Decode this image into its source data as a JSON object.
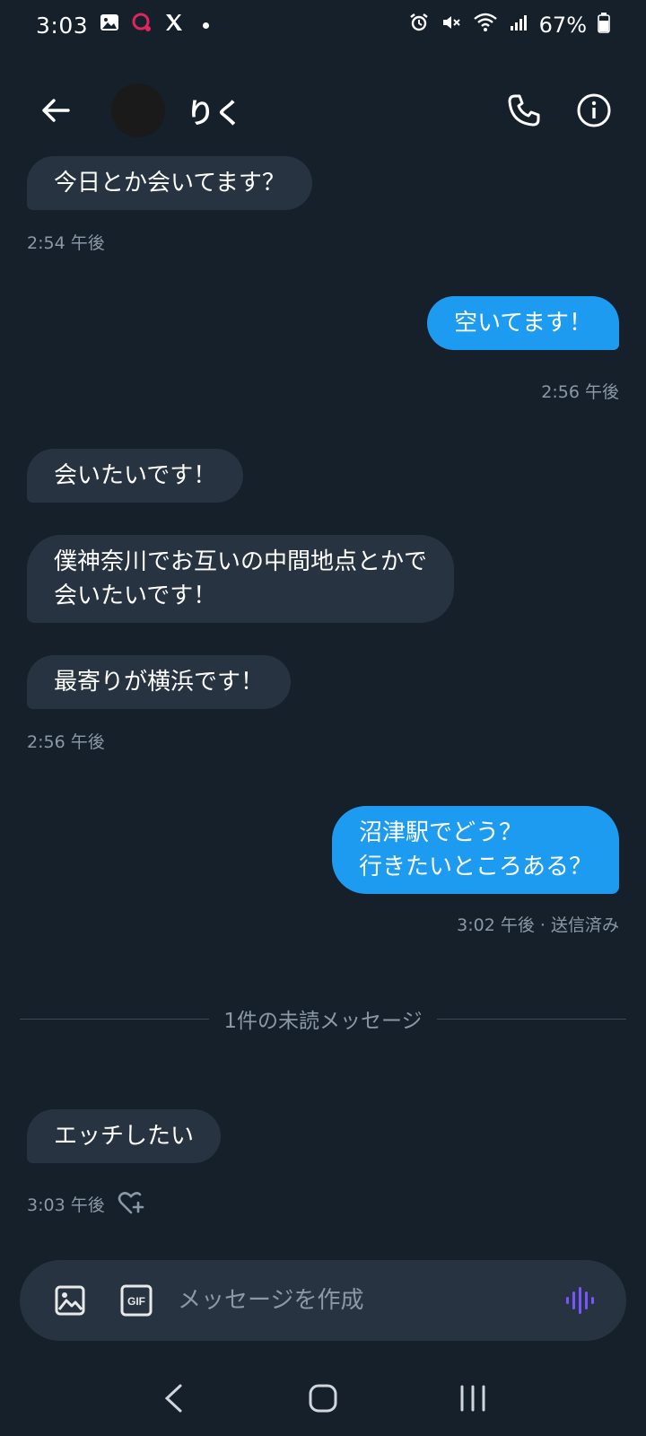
{
  "status_bar": {
    "time": "3:03",
    "battery_percent": "67%"
  },
  "header": {
    "contact_name": "りく"
  },
  "messages": [
    {
      "direction": "received",
      "text": "今日とか会いてます？"
    },
    {
      "direction": "sent",
      "text": "空いてます！"
    },
    {
      "direction": "received",
      "text": "会いたいです！"
    },
    {
      "direction": "received",
      "text": "僕神奈川でお互いの中間地点とかで\n会いたいです！"
    },
    {
      "direction": "received",
      "text": "最寄りが横浜です！"
    },
    {
      "direction": "sent",
      "text": "沼津駅でどう？\n行きたいところある？"
    },
    {
      "direction": "received",
      "text": "エッチしたい"
    }
  ],
  "timestamps": {
    "t1": "2:54 午後",
    "t2": "2:56 午後",
    "t3": "2:56 午後",
    "t4": "3:02 午後 · 送信済み",
    "t5": "3:03 午後"
  },
  "unread_divider": "1件の未読メッセージ",
  "composer": {
    "placeholder": "メッセージを作成",
    "gif_label": "GIF"
  },
  "colors": {
    "background": "#15202b",
    "received_bubble": "#273340",
    "sent_bubble": "#1d9bf0",
    "timestamp": "#8b98a5",
    "voice_icon": "#7856ff"
  }
}
